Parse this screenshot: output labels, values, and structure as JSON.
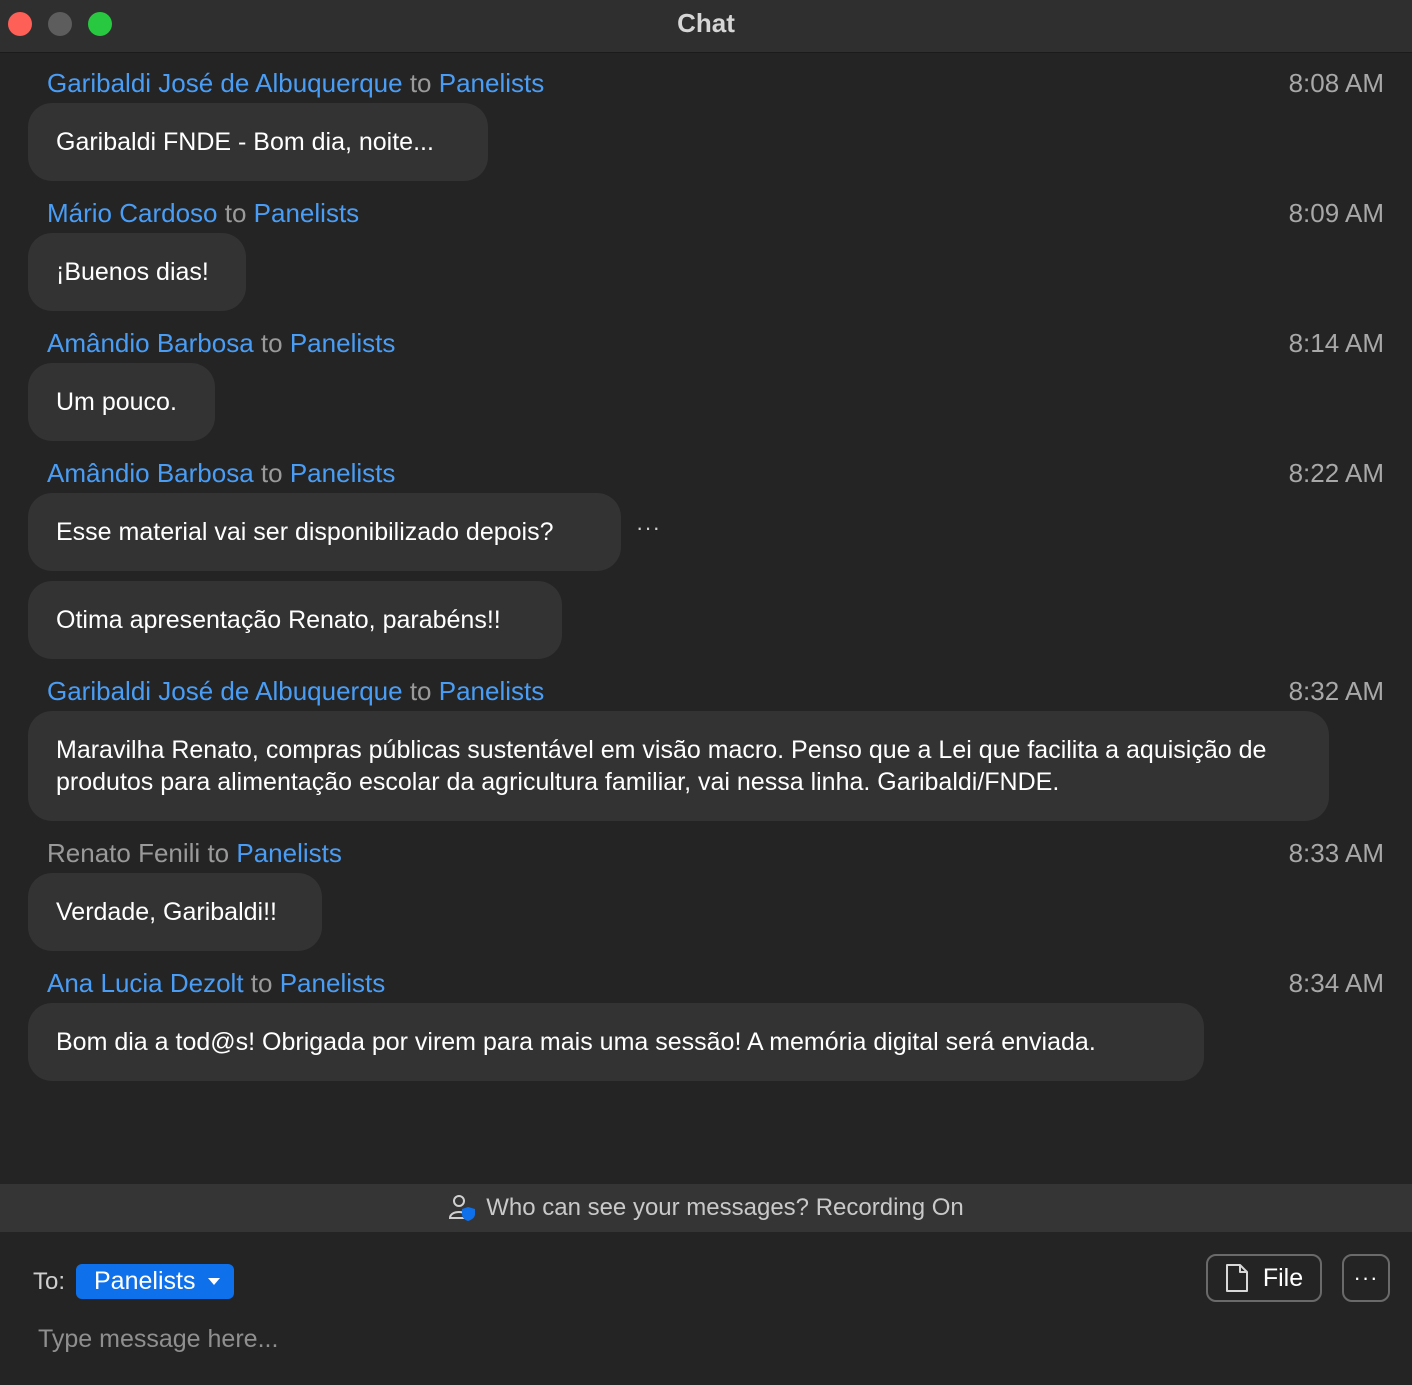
{
  "window": {
    "title": "Chat"
  },
  "messages": [
    {
      "sender": "Garibaldi José de Albuquerque",
      "to_word": "to",
      "recipient": "Panelists",
      "time": "8:08 AM",
      "bubbles": [
        "Garibaldi FNDE - Bom dia, noite..."
      ]
    },
    {
      "sender": "Mário Cardoso",
      "to_word": "to",
      "recipient": "Panelists",
      "time": "8:09 AM",
      "bubbles": [
        "¡Buenos dias!"
      ]
    },
    {
      "sender": "Amândio Barbosa",
      "to_word": "to",
      "recipient": "Panelists",
      "time": "8:14 AM",
      "bubbles": [
        "Um pouco."
      ]
    },
    {
      "sender": "Amândio Barbosa",
      "to_word": "to",
      "recipient": "Panelists",
      "time": "8:22 AM",
      "bubbles": [
        "Esse material vai ser disponibilizado depois?",
        "Otima apresentação Renato, parabéns!!"
      ]
    },
    {
      "sender": "Garibaldi José de Albuquerque",
      "to_word": "to",
      "recipient": "Panelists",
      "time": "8:32 AM",
      "bubbles": [
        "Maravilha Renato, compras públicas sustentável em visão macro. Penso que a Lei que facilita a aquisição de produtos para alimentação escolar da agricultura familiar, vai nessa linha. Garibaldi/FNDE."
      ]
    },
    {
      "sender": "Renato Fenili",
      "to_word": "to",
      "recipient": "Panelists",
      "time": "8:33 AM",
      "bubbles": [
        "Verdade, Garibaldi!!"
      ]
    },
    {
      "sender": "Ana Lucia Dezolt",
      "to_word": "to",
      "recipient": "Panelists",
      "time": "8:34 AM",
      "bubbles": [
        "Bom dia a tod@s! Obrigada por virem para mais uma sessão! A memória digital será enviada."
      ]
    }
  ],
  "message_more_label": "···",
  "notice": {
    "text": "Who can see your messages? Recording On",
    "icon": "person-shield-icon"
  },
  "composer": {
    "to_label": "To:",
    "recipient": "Panelists",
    "file_label": "File",
    "more_label": "···",
    "placeholder": "Type message here..."
  },
  "colors": {
    "accent": "#0e71eb",
    "link": "#4a9df5",
    "background": "#242424",
    "bubble": "#333333"
  }
}
